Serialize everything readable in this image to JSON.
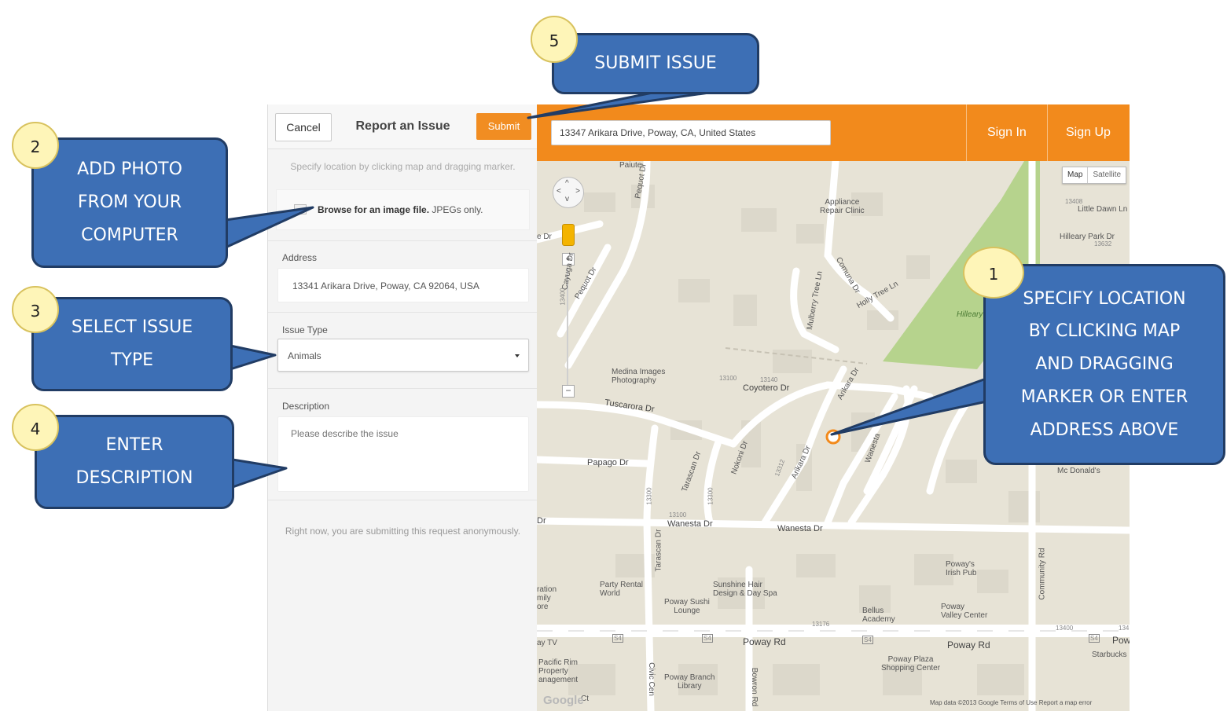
{
  "panel": {
    "cancel_label": "Cancel",
    "title": "Report an Issue",
    "submit_label": "Submit",
    "hint": "Specify location by clicking map and dragging marker.",
    "photo_bold": "Browse for an image file.",
    "photo_rest": " JPEGs only.",
    "address_label": "Address",
    "address_value": "13341 Arikara Drive, Poway, CA 92064, USA",
    "issue_type_label": "Issue Type",
    "issue_type_value": "Animals",
    "description_label": "Description",
    "description_placeholder": "Please describe the issue",
    "anonymous_note": "Right now, you are submitting this request anonymously."
  },
  "header": {
    "search_value": "13347 Arikara Drive, Poway, CA, United States",
    "sign_in": "Sign In",
    "sign_up": "Sign Up",
    "accent_color": "#f28a1c"
  },
  "map": {
    "map_type_map": "Map",
    "map_type_satellite": "Satellite",
    "labels": {
      "appliance": "Appliance\nRepair Clinic",
      "medina": "Medina Images\nPhotography",
      "coyotero": "Coyotero Dr",
      "tuscarora": "Tuscarora Dr",
      "papago": "Papago Dr",
      "wanesta1": "Wanesta Dr",
      "wanesta2": "Wanesta Dr",
      "tarascan": "Tarascan Dr",
      "nokomi": "Nokoni Dr",
      "arikara": "Arikara Dr",
      "arikara2": "Arikara Dr",
      "wanesta3": "Wanesta",
      "pequot": "Pequot Dr",
      "pequot2": "Pequot Dr",
      "cayuga": "Cayuga Dr",
      "mulberry": "Mulberry Tree Ln",
      "holly": "Holly Tree Ln",
      "comuna": "Comuna Dr",
      "paiute": "Paiute",
      "little_dawn": "Little Dawn Ln",
      "hilleary": "Hilleary Park Dr",
      "hilleary2": "Hilleary",
      "mcdonalds": "Mc Donald's",
      "poway_irish": "Poway's\nIrish Pub",
      "poway_valley": "Poway\nValley Center",
      "bellus": "Bellus\nAcademy",
      "poway_sushi": "Poway Sushi\nLounge",
      "sunshine": "Sunshine Hair\nDesign & Day Spa",
      "party": "Party Rental\nWorld",
      "poway_rd1": "Poway Rd",
      "poway_rd2": "Poway Rd",
      "poway_rd3": "Powa",
      "pacific": "Pacific Rim\nProperty\nanagement",
      "branch": "Poway Branch\nLibrary",
      "plaza": "Poway Plaza\nShopping Center",
      "starbucks": "Starbucks",
      "community": "Community Rd",
      "civic": "Civic Cen",
      "bowron": "Bowron Rd",
      "s4a": "S4",
      "s4b": "S4",
      "s4c": "S4",
      "s4d": "S4",
      "ration": "ration\nmily\nore",
      "aytv": "ay TV",
      "dr": "Dr",
      "edr": "e Dr",
      "ct": "Ct",
      "n13400": "13400",
      "n13408": "13408",
      "n13632": "13632",
      "n13100a": "13100",
      "n13140": "13140",
      "n13100b": "13100",
      "n13300": "13300",
      "n13300b": "13300",
      "n13312": "13312",
      "n13176": "13176",
      "n13400b": "13400",
      "n134": "134"
    },
    "footer": "Map data ©2013 Google    Terms of Use    Report a map error",
    "google": "Google",
    "park_color": "#b4d28b"
  },
  "callouts": {
    "c1": {
      "number": "1",
      "lines": [
        "SPECIFY LOCATION",
        "BY CLICKING MAP",
        "AND DRAGGING",
        "MARKER OR ENTER",
        "ADDRESS ABOVE"
      ]
    },
    "c2": {
      "number": "2",
      "lines": [
        "ADD PHOTO",
        "FROM YOUR",
        "COMPUTER"
      ]
    },
    "c3": {
      "number": "3",
      "lines": [
        "SELECT ISSUE",
        "TYPE"
      ]
    },
    "c4": {
      "number": "4",
      "lines": [
        "ENTER",
        "DESCRIPTION"
      ]
    },
    "c5": {
      "number": "5",
      "lines": [
        "SUBMIT ISSUE"
      ]
    },
    "fill_color": "#3d6fb5",
    "badge_color": "#fef5b8"
  }
}
